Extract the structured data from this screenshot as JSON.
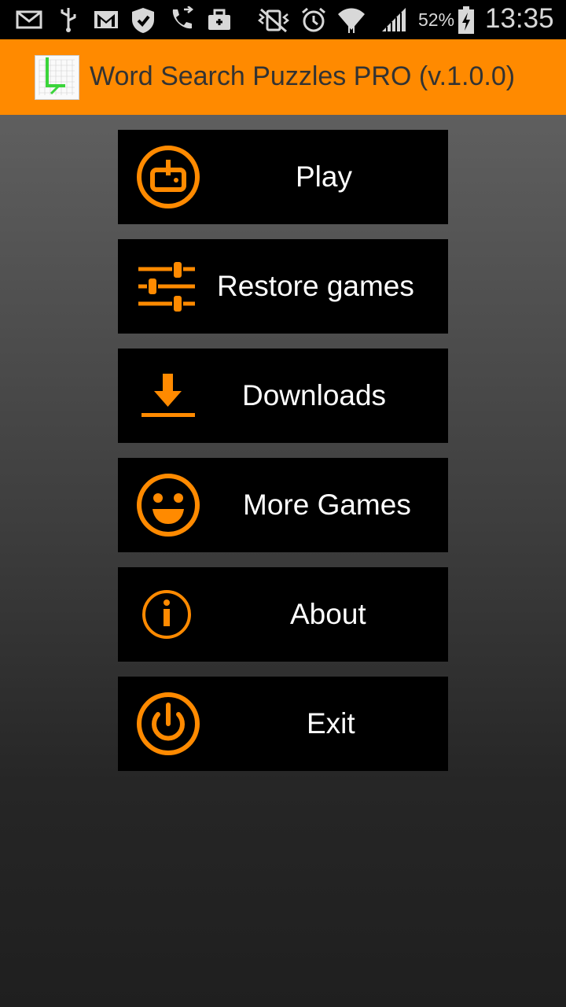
{
  "status_bar": {
    "icons": [
      "mail-icon",
      "usb-icon",
      "gmail-icon",
      "shield-icon",
      "phone-icon",
      "briefcase-icon",
      "mute-vibrate-icon",
      "alarm-icon",
      "wifi-icon",
      "signal-icon",
      "battery-icon"
    ],
    "battery_percent": "52%",
    "time": "13:35"
  },
  "action_bar": {
    "title": "Word Search Puzzles PRO (v.1.0.0)",
    "background_color": "#ff8a00"
  },
  "menu": {
    "accent_color": "#ff8a00",
    "items": [
      {
        "label": "Play",
        "icon": "joystick-icon"
      },
      {
        "label": "Restore games",
        "icon": "sliders-icon"
      },
      {
        "label": "Downloads",
        "icon": "download-icon"
      },
      {
        "label": "More Games",
        "icon": "smiley-icon"
      },
      {
        "label": "About",
        "icon": "info-icon"
      },
      {
        "label": "Exit",
        "icon": "power-icon"
      }
    ]
  }
}
